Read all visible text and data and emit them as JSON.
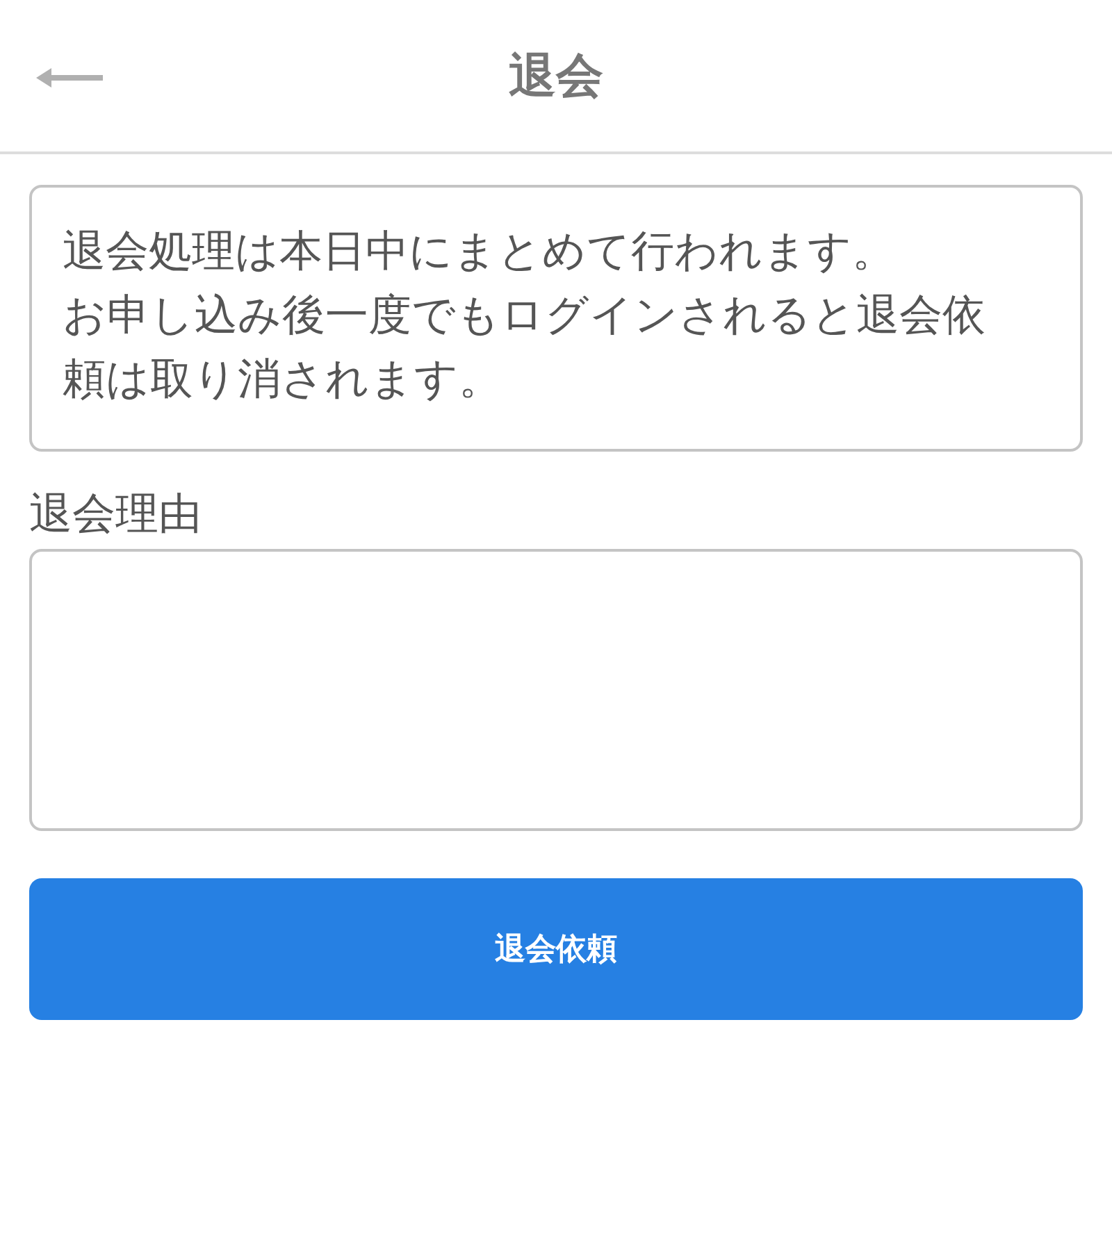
{
  "header": {
    "title": "退会"
  },
  "notice": {
    "paragraphs": [
      "退会処理は本日中にまとめて行われます。",
      "お申し込み後一度でもログインされると退会依頼は取り消されます。"
    ]
  },
  "reason": {
    "label": "退会理由"
  },
  "submit_button": {
    "label": "退会依頼"
  }
}
